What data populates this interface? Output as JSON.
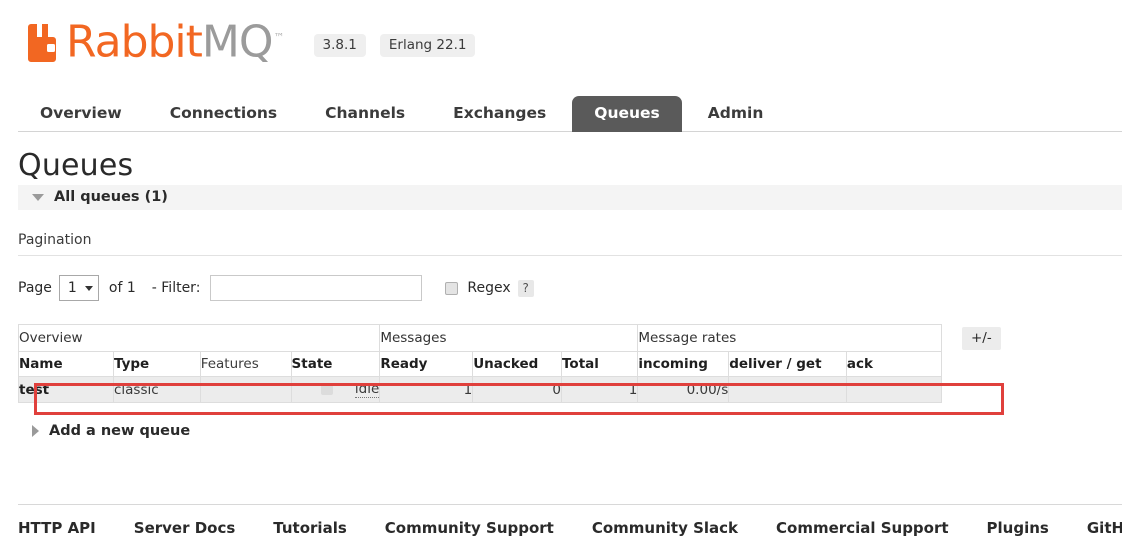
{
  "brand": {
    "name_rabbit": "Rabbit",
    "name_mq": "MQ",
    "trademark": "™",
    "logo_color": "#F26722",
    "mq_color": "#9b9b9b"
  },
  "versions": {
    "server": "3.8.1",
    "erlang": "Erlang 22.1"
  },
  "nav": {
    "tabs": [
      {
        "label": "Overview",
        "active": false
      },
      {
        "label": "Connections",
        "active": false
      },
      {
        "label": "Channels",
        "active": false
      },
      {
        "label": "Exchanges",
        "active": false
      },
      {
        "label": "Queues",
        "active": true
      },
      {
        "label": "Admin",
        "active": false
      }
    ],
    "active_tab_bg": "#5a5a5a"
  },
  "page": {
    "title": "Queues",
    "section_label": "All queues (1)",
    "pagination_heading": "Pagination"
  },
  "pagination": {
    "page_label": "Page",
    "page_value": "1",
    "of_label": "of 1",
    "filter_label": "- Filter:",
    "filter_value": "",
    "filter_placeholder": "",
    "regex_label": "Regex",
    "regex_checked": false,
    "help_label": "?"
  },
  "table": {
    "group_headers": [
      {
        "label": "Overview",
        "span": 4
      },
      {
        "label": "Messages",
        "span": 3
      },
      {
        "label": "Message rates",
        "span": 3
      }
    ],
    "columns": [
      {
        "label": "Name",
        "sortable": true,
        "align": "left"
      },
      {
        "label": "Type",
        "sortable": true,
        "align": "left"
      },
      {
        "label": "Features",
        "sortable": false,
        "align": "left"
      },
      {
        "label": "State",
        "sortable": true,
        "align": "left"
      },
      {
        "label": "Ready",
        "sortable": true,
        "align": "right"
      },
      {
        "label": "Unacked",
        "sortable": true,
        "align": "right"
      },
      {
        "label": "Total",
        "sortable": true,
        "align": "right"
      },
      {
        "label": "incoming",
        "sortable": true,
        "align": "right"
      },
      {
        "label": "deliver / get",
        "sortable": true,
        "align": "left"
      },
      {
        "label": "ack",
        "sortable": true,
        "align": "left"
      }
    ],
    "rows": [
      {
        "name": "test",
        "type": "classic",
        "features": "",
        "state": "idle",
        "ready": "1",
        "unacked": "0",
        "total": "1",
        "incoming": "0.00/s",
        "deliver_get": "",
        "ack": "",
        "highlighted": true
      }
    ],
    "toggle_columns_label": "+/-",
    "highlight_color": "#e0403c"
  },
  "add_queue": {
    "label": "Add a new queue"
  },
  "footer": {
    "links": [
      "HTTP API",
      "Server Docs",
      "Tutorials",
      "Community Support",
      "Community Slack",
      "Commercial Support",
      "Plugins",
      "GitHub"
    ]
  }
}
